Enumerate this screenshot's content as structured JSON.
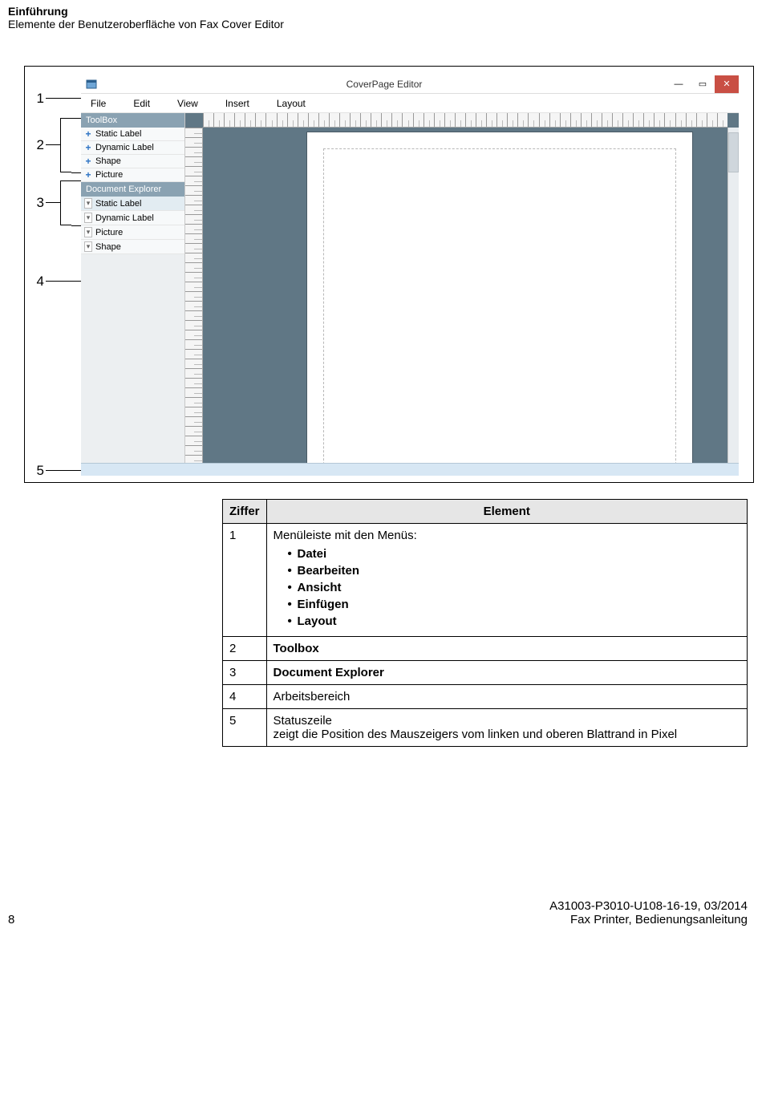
{
  "header": {
    "title": "Einführung",
    "subtitle": "Elemente der Benutzeroberfläche von Fax Cover Editor"
  },
  "callouts": [
    "1",
    "2",
    "3",
    "4",
    "5"
  ],
  "app": {
    "title": "CoverPage Editor",
    "menubar": [
      "File",
      "Edit",
      "View",
      "Insert",
      "Layout"
    ],
    "toolbox": {
      "header": "ToolBox",
      "items": [
        "Static Label",
        "Dynamic Label",
        "Shape",
        "Picture"
      ]
    },
    "docexplorer": {
      "header": "Document Explorer",
      "items": [
        "Static Label",
        "Dynamic Label",
        "Picture",
        "Shape"
      ]
    },
    "winbtn": {
      "min": "—",
      "max": "▭",
      "close": "✕"
    }
  },
  "legend": {
    "header": {
      "col1": "Ziffer",
      "col2": "Element"
    },
    "rows": [
      {
        "num": "1",
        "text": "Menüleiste mit den Menüs:",
        "bullets": [
          "Datei",
          "Bearbeiten",
          "Ansicht",
          "Einfügen",
          "Layout"
        ],
        "bold_bullets": true
      },
      {
        "num": "2",
        "text": "Toolbox",
        "bold": true
      },
      {
        "num": "3",
        "text": "Document Explorer",
        "bold": true
      },
      {
        "num": "4",
        "text": "Arbeitsbereich"
      },
      {
        "num": "5",
        "text": "Statuszeile",
        "extra": "zeigt die Position des Mauszeigers vom linken und oberen Blattrand in Pixel"
      }
    ]
  },
  "footer": {
    "page": "8",
    "docid": "A31003-P3010-U108-16-19, 03/2014",
    "docname": "Fax Printer, Bedienungsanleitung"
  }
}
